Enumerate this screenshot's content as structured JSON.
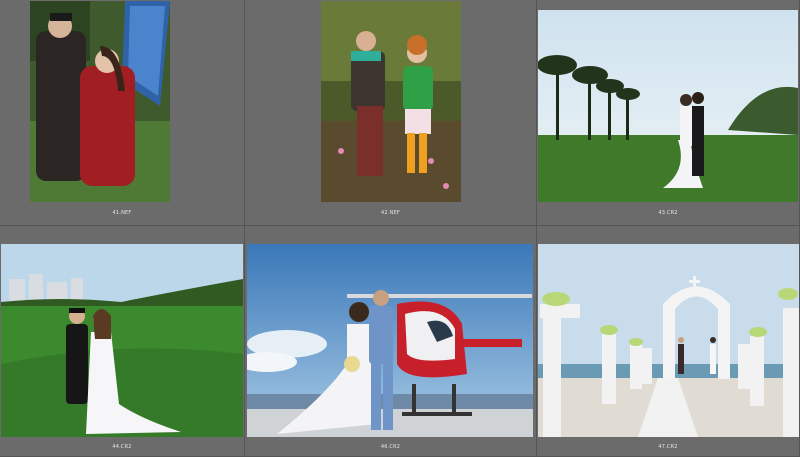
{
  "thumbnails": [
    {
      "filename": "41.NEF",
      "scene": "couple-autumn-coats"
    },
    {
      "filename": "42.NEF",
      "scene": "couple-hats-meadow"
    },
    {
      "filename": "43.CR2",
      "scene": "wedding-palms-lawn"
    },
    {
      "filename": "44.CR2",
      "scene": "wedding-golf-course"
    },
    {
      "filename": "46.CR2",
      "scene": "wedding-helicopter"
    },
    {
      "filename": "47.CR2",
      "scene": "wedding-arch-beach"
    }
  ]
}
